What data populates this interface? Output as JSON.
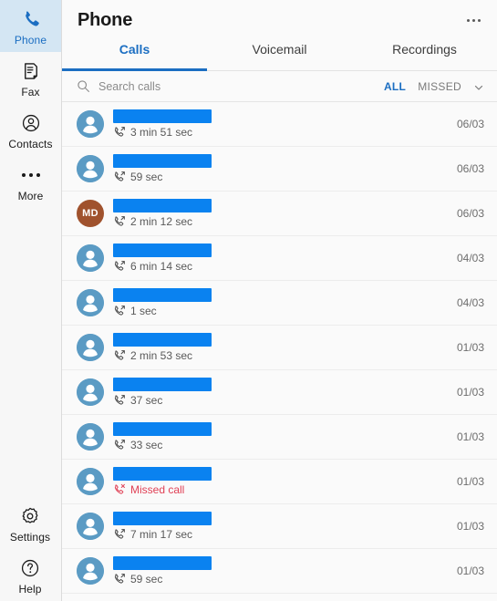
{
  "sidebar": {
    "top_items": [
      {
        "id": "phone",
        "label": "Phone",
        "icon": "phone-icon",
        "active": true
      },
      {
        "id": "fax",
        "label": "Fax",
        "icon": "fax-icon",
        "active": false
      },
      {
        "id": "contacts",
        "label": "Contacts",
        "icon": "contacts-icon",
        "active": false
      },
      {
        "id": "more",
        "label": "More",
        "icon": "more-dots-icon",
        "active": false
      }
    ],
    "bottom_items": [
      {
        "id": "settings",
        "label": "Settings",
        "icon": "gear-icon"
      },
      {
        "id": "help",
        "label": "Help",
        "icon": "question-circle-icon"
      }
    ]
  },
  "header": {
    "title": "Phone",
    "overflow_label": "More options"
  },
  "tabs": [
    {
      "id": "calls",
      "label": "Calls",
      "active": true
    },
    {
      "id": "voicemail",
      "label": "Voicemail",
      "active": false
    },
    {
      "id": "recordings",
      "label": "Recordings",
      "active": false
    }
  ],
  "search": {
    "placeholder": "Search calls",
    "value": ""
  },
  "filters": [
    {
      "id": "all",
      "label": "ALL",
      "active": true
    },
    {
      "id": "missed",
      "label": "MISSED",
      "active": false
    }
  ],
  "filter_chevron": "chevron-down-icon",
  "colors": {
    "accent": "#1b6ec2",
    "redaction": "#0a82f0",
    "avatar": "#5b9bc4",
    "avatar_initials": "#a0522d",
    "missed": "#e04055",
    "sidebar_active_bg": "#d4e6f3"
  },
  "calls": [
    {
      "name": "",
      "name_redacted": true,
      "avatar": "silhouette",
      "initials": "",
      "type": "outgoing",
      "duration": "3 min 51 sec",
      "date": "06/03"
    },
    {
      "name": "",
      "name_redacted": true,
      "avatar": "silhouette",
      "initials": "",
      "type": "outgoing",
      "duration": "59 sec",
      "date": "06/03"
    },
    {
      "name": "",
      "name_redacted": true,
      "avatar": "initials",
      "initials": "MD",
      "type": "outgoing",
      "duration": "2 min 12 sec",
      "date": "06/03"
    },
    {
      "name": "",
      "name_redacted": true,
      "avatar": "silhouette",
      "initials": "",
      "type": "outgoing",
      "duration": "6 min 14 sec",
      "date": "04/03"
    },
    {
      "name": "",
      "name_redacted": true,
      "avatar": "silhouette",
      "initials": "",
      "type": "outgoing",
      "duration": "1 sec",
      "date": "04/03"
    },
    {
      "name": "",
      "name_redacted": true,
      "avatar": "silhouette",
      "initials": "",
      "type": "outgoing",
      "duration": "2 min 53 sec",
      "date": "01/03"
    },
    {
      "name": "",
      "name_redacted": true,
      "avatar": "silhouette",
      "initials": "",
      "type": "outgoing",
      "duration": "37 sec",
      "date": "01/03"
    },
    {
      "name": "",
      "name_redacted": true,
      "avatar": "silhouette",
      "initials": "",
      "type": "outgoing",
      "duration": "33 sec",
      "date": "01/03"
    },
    {
      "name": "",
      "name_redacted": true,
      "avatar": "silhouette",
      "initials": "",
      "type": "missed",
      "duration": "Missed call",
      "date": "01/03"
    },
    {
      "name": "",
      "name_redacted": true,
      "avatar": "silhouette",
      "initials": "",
      "type": "outgoing",
      "duration": "7 min 17 sec",
      "date": "01/03"
    },
    {
      "name": "",
      "name_redacted": true,
      "avatar": "silhouette",
      "initials": "",
      "type": "outgoing",
      "duration": "59 sec",
      "date": "01/03"
    }
  ]
}
